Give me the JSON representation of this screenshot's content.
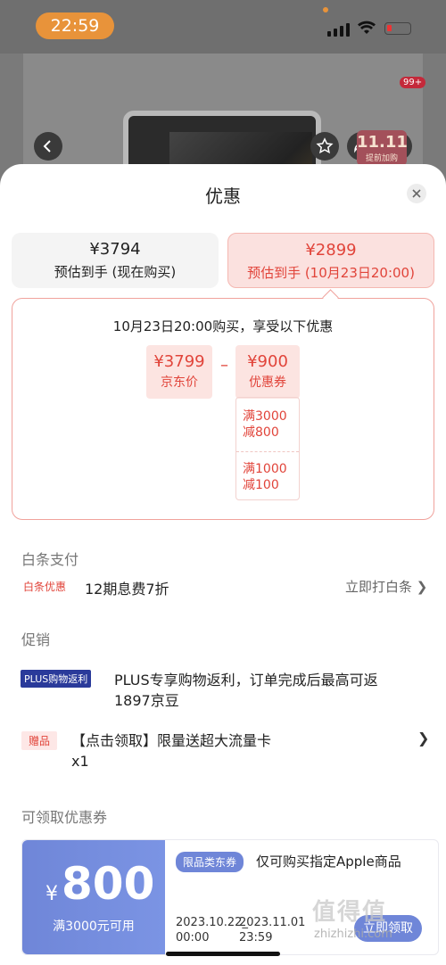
{
  "status_bar": {
    "time": "22:59"
  },
  "product_header": {
    "more_badge": "99+",
    "promo_tag": "11.11",
    "promo_sub": "提前加购"
  },
  "sheet": {
    "title": "优惠",
    "price_now": {
      "price": "¥3794",
      "label": "预估到手 (现在购买)"
    },
    "price_later": {
      "price": "¥2899",
      "label": "预估到手 (10月23日20:00)"
    },
    "detail": {
      "title": "10月23日20:00购买，享受以下优惠",
      "jd_price": {
        "value": "¥3799",
        "label": "京东价"
      },
      "operator": "–",
      "coupon": {
        "value": "¥900",
        "label": "优惠券"
      },
      "rules": [
        {
          "line1": "满3000",
          "line2": "减800"
        },
        {
          "line1": "满1000",
          "line2": "减100"
        }
      ]
    },
    "baitiao": {
      "section": "白条支付",
      "tag": "白条优惠",
      "text": "12期息费7折",
      "action": "立即打白条 ❯"
    },
    "promotion": {
      "section": "促销",
      "plus_tag": "PLUS购物返利",
      "plus_line1": "PLUS专享购物返利，订单完成后最高可返",
      "plus_line2": "1897京豆",
      "gift_tag": "赠品",
      "gift_line1": "【点击领取】限量送超大流量卡",
      "gift_line2": "x1",
      "gift_chevron": "❯"
    },
    "coupons": {
      "section": "可领取优惠券",
      "yen": "¥",
      "amount": "800",
      "condition": "满3000元可用",
      "tag": "限品类东券",
      "desc": "仅可购买指定Apple商品",
      "start_date": "2023.10.22",
      "start_time": "00:00",
      "sep": "_",
      "end_date": "2023.11.01",
      "end_time": "23:59",
      "button": "立即领取"
    }
  },
  "watermark": {
    "text": "值得值",
    "url": "zhizhizhi.com"
  }
}
